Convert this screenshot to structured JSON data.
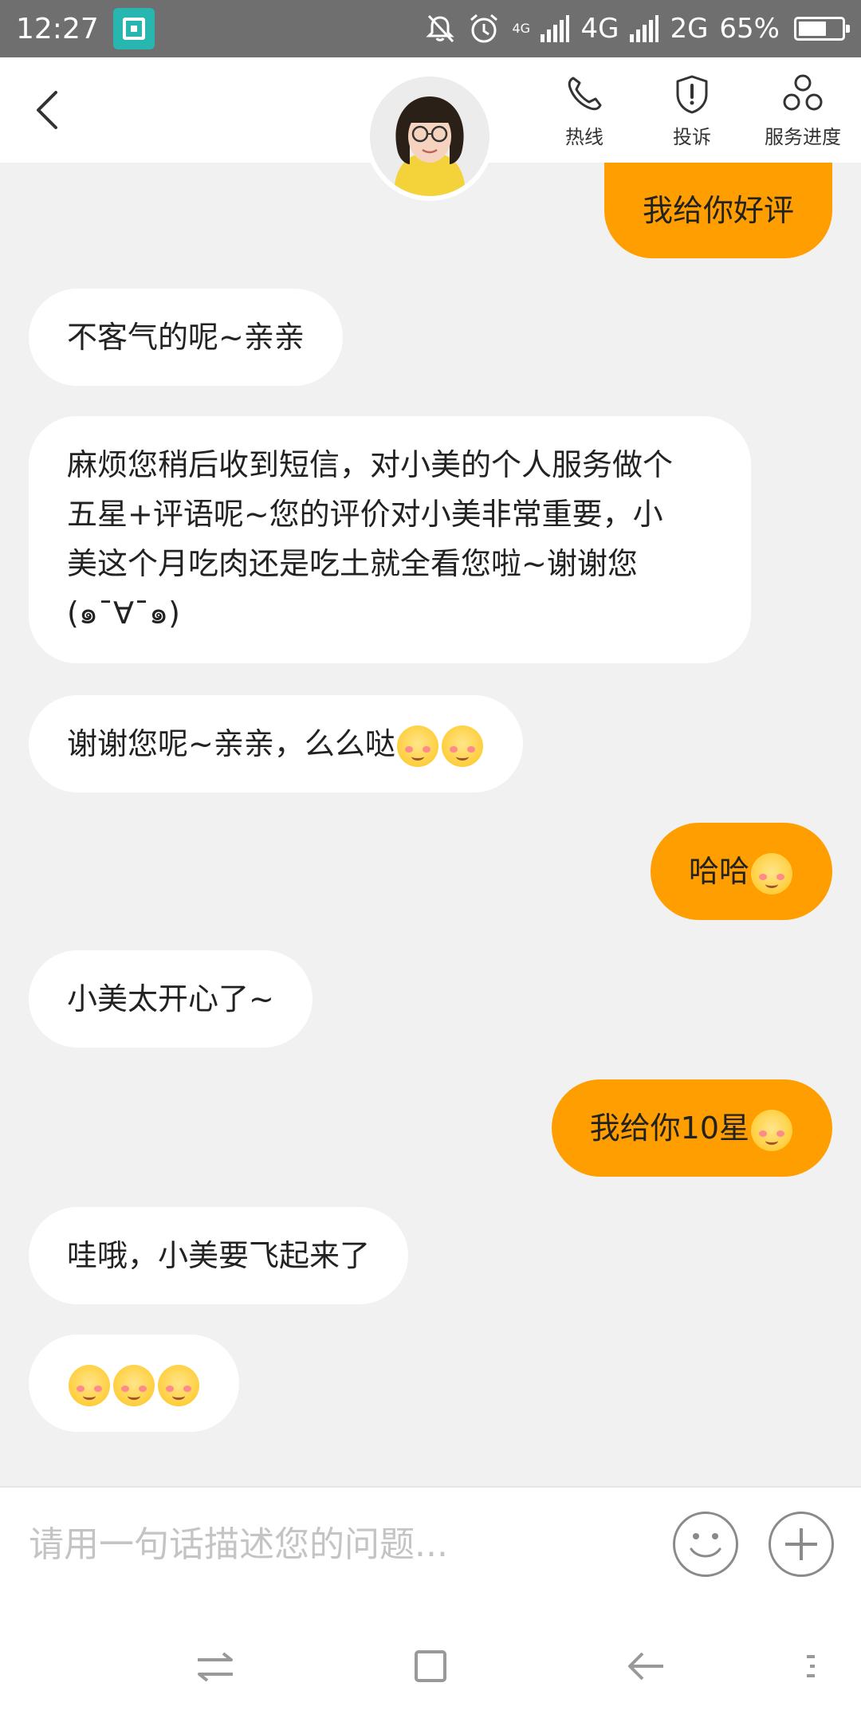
{
  "status_bar": {
    "time": "12:27",
    "net_small": "4G",
    "net1": "4G",
    "net2": "2G",
    "battery": "65%",
    "battery_level": 0.65
  },
  "header": {
    "actions": [
      {
        "label": "热线",
        "icon": "phone-icon"
      },
      {
        "label": "投诉",
        "icon": "shield-exclamation-icon"
      },
      {
        "label": "服务进度",
        "icon": "progress-nodes-icon"
      }
    ]
  },
  "messages": [
    {
      "side": "out",
      "text": "我给你好评"
    },
    {
      "side": "in",
      "text": "不客气的呢~亲亲"
    },
    {
      "side": "in",
      "lines": [
        "麻烦您稍后收到短信，对小美的个人服务做个",
        "五星+评语呢~您的评价对小美非常重要，小",
        "美这个月吃肉还是吃土就全看您啦~谢谢您",
        "(๑¯∀¯๑)"
      ]
    },
    {
      "side": "in",
      "text": "谢谢您呢~亲亲，么么哒",
      "emoji": [
        "blush-emoji",
        "blush-emoji"
      ]
    },
    {
      "side": "out",
      "text": "哈哈",
      "emoji": [
        "grin-emoji"
      ]
    },
    {
      "side": "in",
      "text": "小美太开心了~"
    },
    {
      "side": "out",
      "text": "我给你10星",
      "emoji": [
        "shy-emoji"
      ]
    },
    {
      "side": "in",
      "text": "哇哦，小美要飞起来了"
    },
    {
      "side": "in",
      "emoji": [
        "pleading-emoji",
        "pleading-emoji",
        "pleading-emoji"
      ]
    }
  ],
  "input": {
    "placeholder": "请用一句话描述您的问题..."
  },
  "colors": {
    "accent": "#ff9e00",
    "status_bar": "#6f6f6f",
    "chat_bg": "#f1f1f1"
  }
}
